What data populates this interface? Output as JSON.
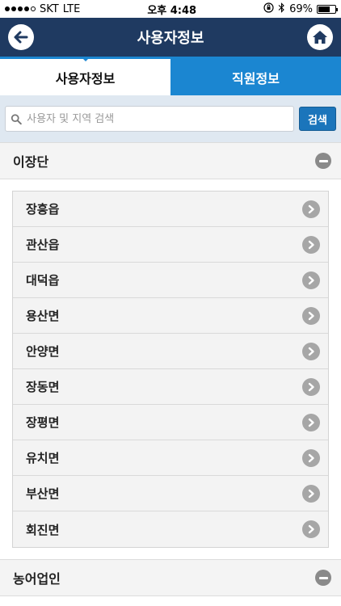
{
  "status_bar": {
    "carrier": "SKT",
    "network": "LTE",
    "time": "오후 4:48",
    "battery": "69%",
    "battery_level": 0.69
  },
  "header": {
    "title": "사용자정보"
  },
  "tabs": [
    {
      "label": "사용자정보",
      "active": true
    },
    {
      "label": "직원정보",
      "active": false
    }
  ],
  "search": {
    "placeholder": "사용자 및 지역 검색",
    "value": "",
    "button_label": "검색"
  },
  "sections": [
    {
      "title": "이장단",
      "items": [
        "장흥읍",
        "관산읍",
        "대덕읍",
        "용산면",
        "안양면",
        "장동면",
        "장평면",
        "유치면",
        "부산면",
        "회진면"
      ]
    },
    {
      "title": "농어업인",
      "items": []
    }
  ],
  "colors": {
    "header_bg": "#1f3a61",
    "tab_accent": "#1b86d1",
    "search_bg": "#dfe8f1",
    "search_button": "#1b75bb"
  }
}
